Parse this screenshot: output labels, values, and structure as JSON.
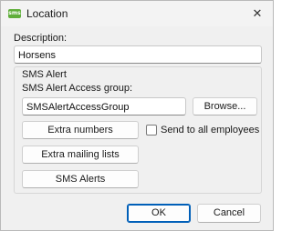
{
  "window": {
    "title": "Location",
    "app_icon_text": "sms",
    "close_glyph": "✕"
  },
  "description": {
    "label": "Description:",
    "value": "Horsens"
  },
  "sms_alert": {
    "group_title": "SMS Alert",
    "access_group_label": "SMS Alert Access group:",
    "access_group_value": "SMSAlertAccessGroup",
    "browse_label": "Browse...",
    "extra_numbers_label": "Extra numbers",
    "send_all_label": "Send to all employees",
    "send_all_checked": false,
    "extra_mailing_label": "Extra mailing lists",
    "sms_alerts_label": "SMS Alerts"
  },
  "footer": {
    "ok_label": "OK",
    "cancel_label": "Cancel"
  }
}
